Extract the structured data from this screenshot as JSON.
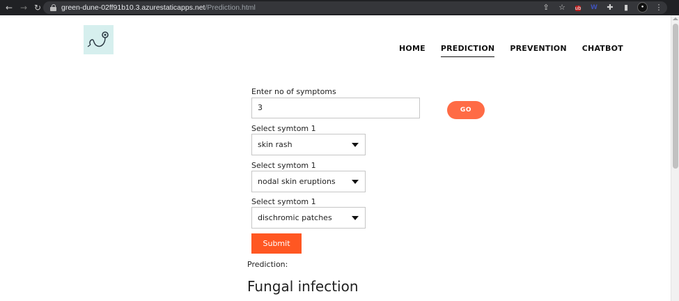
{
  "browser": {
    "url_host": "green-dune-02ff91b10.3.azurestaticapps.net",
    "url_path": "/Prediction.html",
    "icons": [
      "back-icon",
      "forward-icon",
      "reload-icon",
      "lock-icon",
      "share-icon",
      "star-icon",
      "extension-icon",
      "side-panel-icon",
      "profile-icon",
      "menu-icon"
    ]
  },
  "nav": {
    "items": [
      {
        "label": "HOME"
      },
      {
        "label": "PREDICTION"
      },
      {
        "label": "PREVENTION"
      },
      {
        "label": "CHATBOT"
      }
    ],
    "active": "PREDICTION"
  },
  "form": {
    "count_label": "Enter no of symptoms",
    "count_value": "3",
    "go_label": "GO",
    "symptoms": [
      {
        "label": "Select symtom 1",
        "value": "skin rash"
      },
      {
        "label": "Select symtom 1",
        "value": "nodal skin eruptions"
      },
      {
        "label": "Select symtom 1",
        "value": "dischromic patches"
      }
    ],
    "submit_label": "Submit"
  },
  "result": {
    "label": "Prediction:",
    "value": "Fungal infection"
  },
  "colors": {
    "accent": "#ff5722",
    "go_button": "#ff6b45",
    "logo_bg": "#d6efee"
  }
}
